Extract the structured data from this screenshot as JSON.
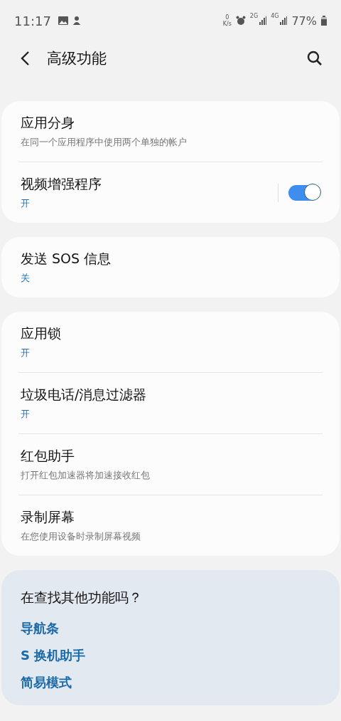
{
  "status_bar": {
    "time": "11:17",
    "speed_value": "0",
    "speed_unit": "K/s",
    "sim1": "2G",
    "sim2": "4G",
    "battery": "77%"
  },
  "header": {
    "title": "高级功能"
  },
  "groups": [
    {
      "items": [
        {
          "title": "应用分身",
          "subtitle": "在同一个应用程序中使用两个单独的帐户",
          "kind": "description"
        },
        {
          "title": "视频增强程序",
          "subtitle": "开",
          "kind": "status",
          "toggle": {
            "on": true
          }
        }
      ]
    },
    {
      "items": [
        {
          "title": "发送 SOS 信息",
          "subtitle": "关",
          "kind": "status"
        }
      ]
    },
    {
      "items": [
        {
          "title": "应用锁",
          "subtitle": "开",
          "kind": "status"
        },
        {
          "title": "垃圾电话/消息过滤器",
          "subtitle": "开",
          "kind": "status"
        },
        {
          "title": "红包助手",
          "subtitle": "打开红包加速器将加速接收红包",
          "kind": "description"
        },
        {
          "title": "录制屏幕",
          "subtitle": "在您使用设备时录制屏幕视频",
          "kind": "description"
        }
      ]
    }
  ],
  "suggestions": {
    "title": "在查找其他功能吗？",
    "links": [
      "导航条",
      "S 换机助手",
      "简易模式"
    ]
  }
}
